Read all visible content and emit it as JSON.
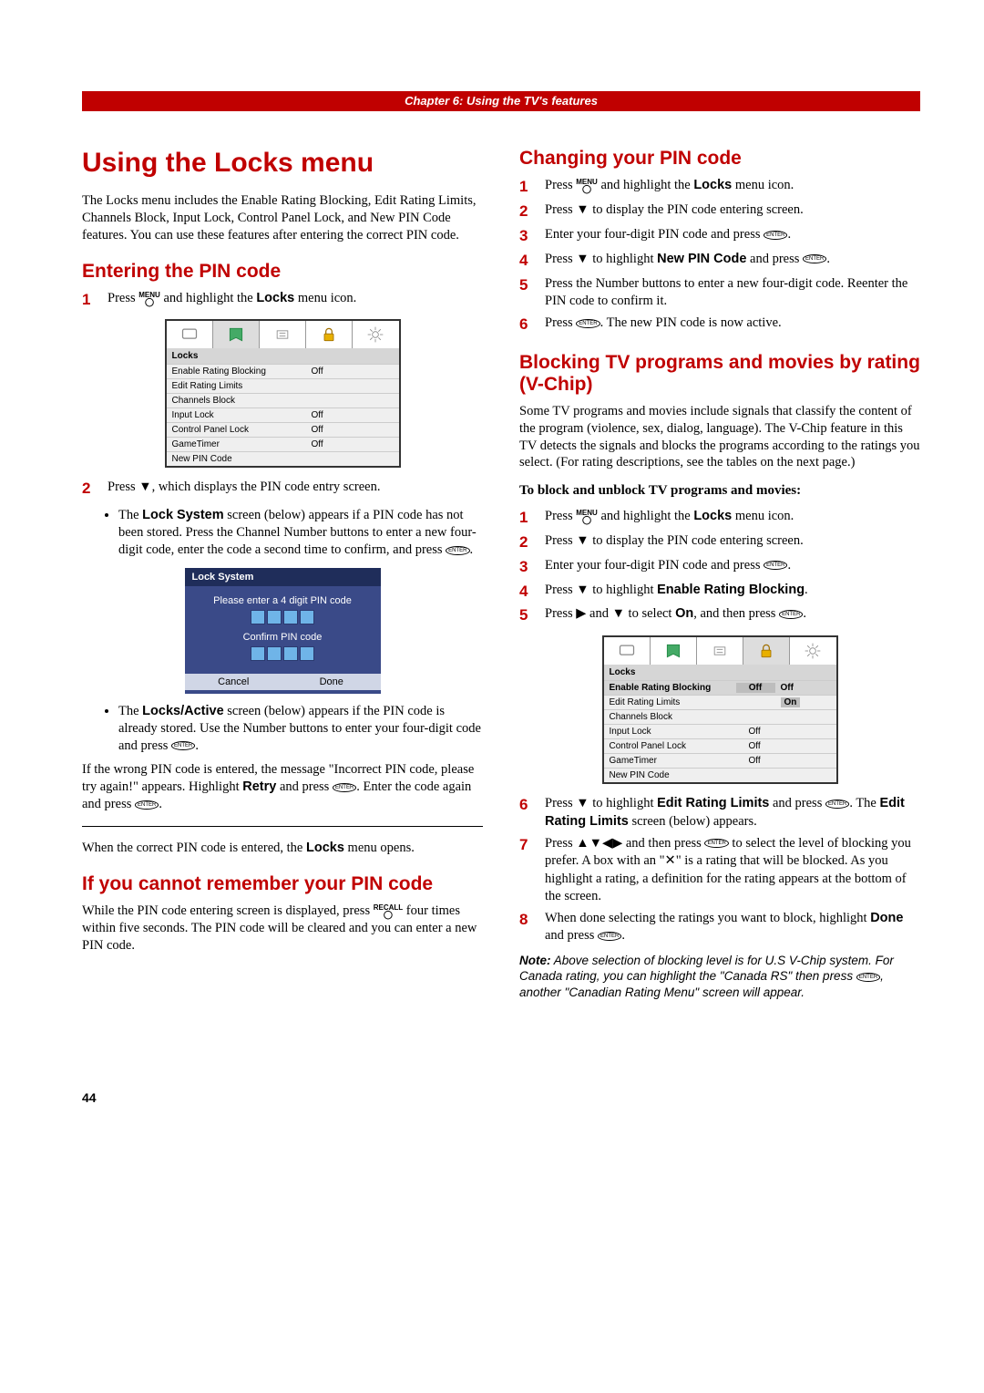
{
  "chapter_header": "Chapter 6: Using the TV's features",
  "page_number": "44",
  "left": {
    "h1": "Using the Locks menu",
    "intro": "The Locks menu includes the Enable Rating Blocking, Edit Rating Limits, Channels Block, Input Lock, Control Panel Lock, and New PIN Code features. You can use these features after entering the correct PIN code.",
    "h2_entering": "Entering the PIN code",
    "step1_pre": "Press ",
    "step1_post": " and highlight the ",
    "locks_word": "Locks",
    "step1_end": " menu icon.",
    "menu1": {
      "title": "Locks",
      "items": [
        {
          "label": "Enable Rating Blocking",
          "val": "Off"
        },
        {
          "label": "Edit Rating Limits",
          "val": ""
        },
        {
          "label": "Channels Block",
          "val": ""
        },
        {
          "label": "Input Lock",
          "val": "Off"
        },
        {
          "label": "Control Panel Lock",
          "val": "Off"
        },
        {
          "label": "GameTimer",
          "val": "Off"
        },
        {
          "label": "New PIN Code",
          "val": ""
        }
      ]
    },
    "step2_text": "Press ▼, which displays the PIN code entry screen.",
    "bullet1_pre": "The ",
    "bullet1_bold": "Lock System",
    "bullet1_post": " screen (below) appears if a PIN code has not been stored. Press the Channel Number buttons to enter a new four-digit code, enter the code a second time to confirm, and press ",
    "lock_system": {
      "title": "Lock System",
      "line1": "Please enter a 4 digit PIN code",
      "line2": "Confirm PIN code",
      "cancel": "Cancel",
      "done": "Done"
    },
    "bullet2_pre": "The ",
    "bullet2_bold": "Locks/Active",
    "bullet2_post": " screen (below) appears if the PIN code is already stored. Use the Number buttons to enter your four-digit code and press ",
    "wrong_pin_pre": "If the wrong PIN code is entered, the message \"Incorrect PIN code, please try again!\" appears. Highlight ",
    "retry": "Retry",
    "wrong_pin_mid": " and press ",
    "wrong_pin_end": ". Enter the code again and press ",
    "correct_pin_pre": "When the correct PIN code is entered, the ",
    "correct_pin_bold": "Locks",
    "correct_pin_post": " menu opens.",
    "h2_forgot": "If you cannot remember your PIN code",
    "forgot_pre": "While the PIN code entering screen is displayed, press ",
    "forgot_post": " four times within five seconds. The PIN code will be cleared and you can enter a new PIN code."
  },
  "right": {
    "h2_change": "Changing your PIN code",
    "csteps": [
      {
        "pre": "Press ",
        "mid": " and highlight the ",
        "bold": "Locks",
        "end": " menu icon."
      },
      {
        "text": "Press ▼ to display the PIN code entering screen."
      },
      {
        "pre": "Enter your four-digit PIN code and press ",
        "enter": true,
        "end": "."
      },
      {
        "pre": "Press ▼ to highlight ",
        "bold": "New PIN Code",
        "mid": " and press ",
        "enter": true,
        "end": "."
      },
      {
        "text": "Press the Number buttons to enter a new four-digit code. Reenter the PIN code to confirm it."
      },
      {
        "pre": "Press ",
        "enter": true,
        "end": ". The new PIN code is now active."
      }
    ],
    "h2_block": "Blocking TV programs and movies by rating (V-Chip)",
    "block_intro": "Some TV programs and movies include signals that classify the content of the program (violence, sex, dialog, language). The V-Chip feature in this TV detects the signals and blocks the programs according to the ratings you select. (For rating descriptions, see the tables on the next page.)",
    "to_block_heading": "To block and unblock TV programs and movies:",
    "bsteps": [
      {
        "pre": "Press ",
        "menu": true,
        "mid": " and highlight the ",
        "bold": "Locks",
        "end": " menu icon."
      },
      {
        "text": "Press ▼ to display the PIN code entering screen."
      },
      {
        "pre": "Enter your four-digit PIN code and press ",
        "enter": true,
        "end": "."
      },
      {
        "pre": "Press ▼ to highlight ",
        "bold": "Enable Rating Blocking",
        "end": "."
      },
      {
        "pre": "Press ▶ and ▼ to select ",
        "bold": "On",
        "mid": ", and then press ",
        "enter": true,
        "end": "."
      }
    ],
    "menu2": {
      "title": "Locks",
      "items": [
        {
          "label": "Enable Rating Blocking",
          "val": "Off",
          "val2": "Off",
          "highlight": true
        },
        {
          "label": "Edit Rating Limits",
          "val": "",
          "val2": "On",
          "sel2": true
        },
        {
          "label": "Channels Block",
          "val": "",
          "val2": ""
        },
        {
          "label": "Input Lock",
          "val": "Off",
          "val2": ""
        },
        {
          "label": "Control Panel Lock",
          "val": "Off",
          "val2": ""
        },
        {
          "label": "GameTimer",
          "val": "Off",
          "val2": ""
        },
        {
          "label": "New PIN Code",
          "val": "",
          "val2": ""
        }
      ]
    },
    "step6_pre": "Press ▼ to highlight ",
    "step6_bold1": "Edit Rating Limits",
    "step6_mid": " and press ",
    "step6_post": ". The ",
    "step6_bold2": "Edit Rating Limits",
    "step6_end": " screen (below) appears.",
    "step7_pre": "Press ▲▼◀▶ and then press ",
    "step7_mid": " to select the level of blocking you prefer. A box with an \"✕\" is a rating that will be blocked. As you highlight a rating, a definition for the rating appears at the bottom of the screen.",
    "step8_pre": "When done selecting the ratings you want to block, highlight ",
    "step8_bold": "Done",
    "step8_mid": " and press ",
    "note_bold": "Note:",
    "note_text": " Above selection of blocking level is for U.S V-Chip system. For Canada rating, you can highlight the \"Canada RS\" then press ",
    "note_end": ", another \"Canadian Rating Menu\" screen will appear."
  },
  "icons": {
    "menu_label": "MENU",
    "recall_label": "RECALL",
    "enter_label": "ENTER"
  }
}
